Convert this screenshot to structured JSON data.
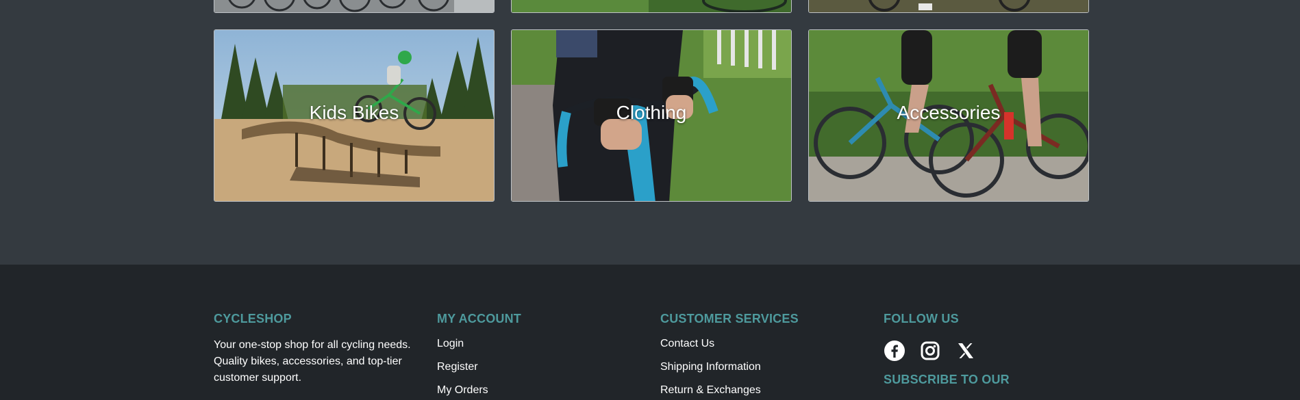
{
  "categories": [
    {
      "label": "Kids Bikes"
    },
    {
      "label": "Clothing"
    },
    {
      "label": "Accessories"
    }
  ],
  "footer": {
    "brand": {
      "title": "CYCLESHOP",
      "description": "Your one-stop shop for all cycling needs. Quality bikes, accessories, and top-tier customer support."
    },
    "account": {
      "title": "MY ACCOUNT",
      "links": [
        "Login",
        "Register",
        "My Orders"
      ]
    },
    "services": {
      "title": "CUSTOMER SERVICES",
      "links": [
        "Contact Us",
        "Shipping Information",
        "Return & Exchanges"
      ]
    },
    "follow": {
      "title": "FOLLOW US",
      "icons": [
        "facebook-icon",
        "instagram-icon",
        "x-icon"
      ],
      "subscribe_title": "SUBSCRIBE TO OUR"
    }
  },
  "colors": {
    "page_bg": "#343a40",
    "footer_bg": "#212529",
    "heading_accent": "#4e9a9d",
    "text": "#ffffff"
  }
}
